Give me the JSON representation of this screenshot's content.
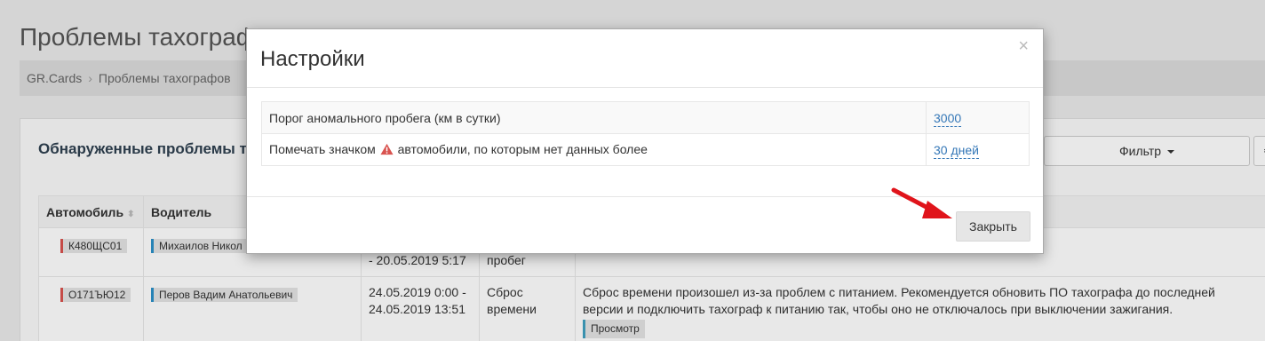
{
  "page": {
    "title": "Проблемы тахографов",
    "breadcrumb": [
      "GR.Cards",
      "Проблемы тахографов"
    ]
  },
  "panel": {
    "title": "Обнаруженные проблемы тахографов",
    "filter_label": "Фильтр",
    "columns": [
      "Автомобиль",
      "Водитель"
    ],
    "rows": [
      {
        "vehicle": "К480ЩС01",
        "driver": "Михаилов Никол",
        "period": [
          "",
          "- 20.05.2019 5:17"
        ],
        "type": [
          "пробег"
        ],
        "description": ""
      },
      {
        "vehicle": "О171ЪЮ12",
        "driver": "Перов Вадим Анатольевич",
        "period": [
          "24.05.2019 0:00 -",
          "24.05.2019 13:51"
        ],
        "type": [
          "Сброс",
          "времени"
        ],
        "description": "Сброс времени произошел из-за проблем с питанием. Рекомендуется обновить ПО тахографа до последней версии и подключить тахограф к питанию так, чтобы оно не отключалось при выключении зажигания.",
        "action": "Просмотр"
      }
    ]
  },
  "modal": {
    "title": "Настройки",
    "close_symbol": "×",
    "settings": [
      {
        "label": "Порог аномального пробега (км в сутки)",
        "value": "3000"
      },
      {
        "label_before": "Помечать значком",
        "label_after": "автомобили, по которым нет данных более",
        "value": "30 дней"
      }
    ],
    "close_button": "Закрыть"
  },
  "colors": {
    "accent_link": "#3477b7",
    "warning": "#d9534f",
    "arrow": "#e0141b"
  }
}
